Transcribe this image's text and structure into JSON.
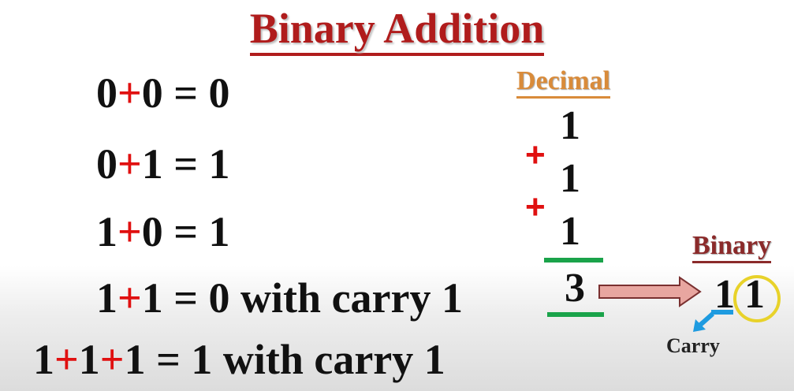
{
  "title": "Binary Addition",
  "rules": [
    {
      "a": "0",
      "op": "+",
      "b": "0",
      "rest": "= 0"
    },
    {
      "a": "0",
      "op": "+",
      "b": "1",
      "rest": "= 1"
    },
    {
      "a": "1",
      "op": "+",
      "b": "0",
      "rest": "= 1"
    },
    {
      "a": "1",
      "op": "+",
      "b": "1",
      "rest": "= 0 with carry 1"
    },
    {
      "a": "1",
      "op": "+",
      "b": "1",
      "op2": "+",
      "c": "1",
      "rest": "= 1 with carry 1"
    }
  ],
  "decimal": {
    "header": "Decimal",
    "digits": [
      "1",
      "1",
      "1"
    ],
    "plus": "+",
    "sum": "3"
  },
  "binary": {
    "header": "Binary",
    "carry_digit": "1",
    "sum_digit": "1",
    "carry_label": "Carry"
  },
  "colors": {
    "title": "#b01c1c",
    "plus": "#e01010",
    "decimal_header": "#d98b3a",
    "binary_header": "#8b2a2a",
    "rule_lines": "#1aa34a",
    "arrow": "#e8a6a0",
    "circle": "#e8d22a",
    "carry_arrow": "#1e9be0"
  }
}
